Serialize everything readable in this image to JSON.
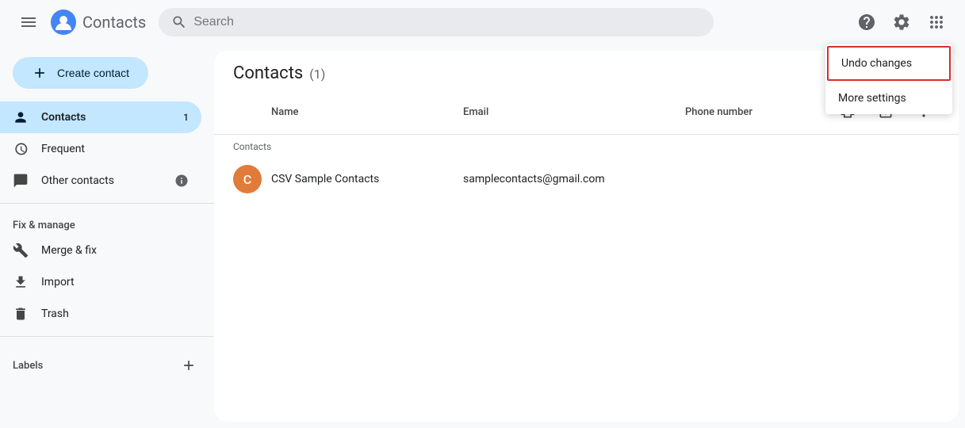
{
  "app": {
    "title": "Contacts",
    "search_placeholder": "Search"
  },
  "sidebar": {
    "create_button_label": "Create contact",
    "items": [
      {
        "id": "contacts",
        "label": "Contacts",
        "badge": "1",
        "active": true
      },
      {
        "id": "frequent",
        "label": "Frequent",
        "badge": null,
        "active": false
      },
      {
        "id": "other-contacts",
        "label": "Other contacts",
        "badge": null,
        "active": false
      }
    ],
    "fix_manage_label": "Fix & manage",
    "manage_items": [
      {
        "id": "merge-fix",
        "label": "Merge & fix"
      },
      {
        "id": "import",
        "label": "Import"
      },
      {
        "id": "trash",
        "label": "Trash"
      }
    ],
    "labels_label": "Labels"
  },
  "main": {
    "title": "Contacts",
    "count": "(1)",
    "columns": {
      "name": "Name",
      "email": "Email",
      "phone": "Phone number"
    },
    "group_label": "Contacts",
    "contacts": [
      {
        "initials": "C",
        "name": "CSV Sample Contacts",
        "email": "samplecontacts@gmail.com",
        "phone": "",
        "avatar_color": "#e07b39"
      }
    ]
  },
  "dropdown": {
    "items": [
      {
        "id": "undo-changes",
        "label": "Undo changes",
        "highlighted": true
      },
      {
        "id": "more-settings",
        "label": "More settings",
        "highlighted": false
      }
    ]
  }
}
